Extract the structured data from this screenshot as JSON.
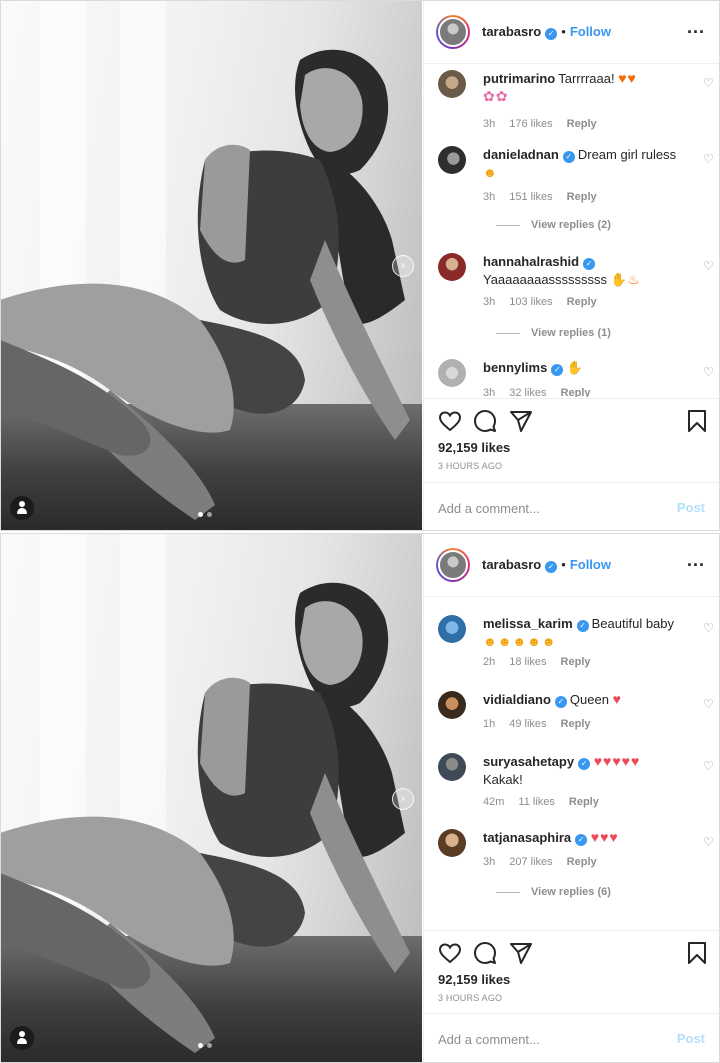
{
  "posts": [
    {
      "header": {
        "username": "tarabasro",
        "follow_label": "Follow",
        "separator": "•",
        "more": "..."
      },
      "comments": [
        {
          "username": "putrimarino",
          "verified": false,
          "text": "Tarrrraaa!",
          "emoji_line": "",
          "time": "3h",
          "likes": "176 likes",
          "reply": "Reply",
          "view_replies": ""
        },
        {
          "username": "danieladnan",
          "verified": true,
          "text": "Dream girl ruless",
          "emoji_line": "",
          "time": "3h",
          "likes": "151 likes",
          "reply": "Reply",
          "view_replies": "View replies (2)"
        },
        {
          "username": "hannahalrashid",
          "verified": true,
          "text": "",
          "emoji_line": "Yaaaaaaaasssssssss",
          "time": "3h",
          "likes": "103 likes",
          "reply": "Reply",
          "view_replies": "View replies (1)"
        },
        {
          "username": "bennylims",
          "verified": true,
          "text": "",
          "emoji_line": "",
          "time": "3h",
          "likes": "32 likes",
          "reply": "Reply",
          "view_replies": ""
        }
      ],
      "likes": "92,159 likes",
      "time_ago": "3 HOURS AGO",
      "comment_placeholder": "Add a comment...",
      "post_label": "Post",
      "carousel_next": "›"
    },
    {
      "header": {
        "username": "tarabasro",
        "follow_label": "Follow",
        "separator": "•",
        "more": "..."
      },
      "comments": [
        {
          "username": "melissa_karim",
          "verified": true,
          "text": "Beautiful baby",
          "emoji_line": "",
          "time": "2h",
          "likes": "18 likes",
          "reply": "Reply",
          "view_replies": ""
        },
        {
          "username": "vidialdiano",
          "verified": true,
          "text": "Queen",
          "emoji_line": "",
          "time": "1h",
          "likes": "49 likes",
          "reply": "Reply",
          "view_replies": ""
        },
        {
          "username": "suryasahetapy",
          "verified": true,
          "text": "",
          "emoji_line": "Kakak!",
          "time": "42m",
          "likes": "11 likes",
          "reply": "Reply",
          "view_replies": ""
        },
        {
          "username": "tatjanasaphira",
          "verified": true,
          "text": "",
          "emoji_line": "",
          "time": "3h",
          "likes": "207 likes",
          "reply": "Reply",
          "view_replies": "View replies (6)"
        }
      ],
      "likes": "92,159 likes",
      "time_ago": "3 HOURS AGO",
      "comment_placeholder": "Add a comment...",
      "post_label": "Post",
      "carousel_next": "›"
    }
  ],
  "icons": {
    "like": "heart-icon",
    "comment": "comment-icon",
    "share": "share-icon",
    "save": "bookmark-icon",
    "tag": "user-tag-icon",
    "verified_glyph": "✓"
  },
  "colors": {
    "accent": "#3897f0",
    "text": "#262626",
    "muted": "#8e8e8e",
    "post_disabled": "#b2dffc",
    "emoji_heart": "#ed4956"
  }
}
